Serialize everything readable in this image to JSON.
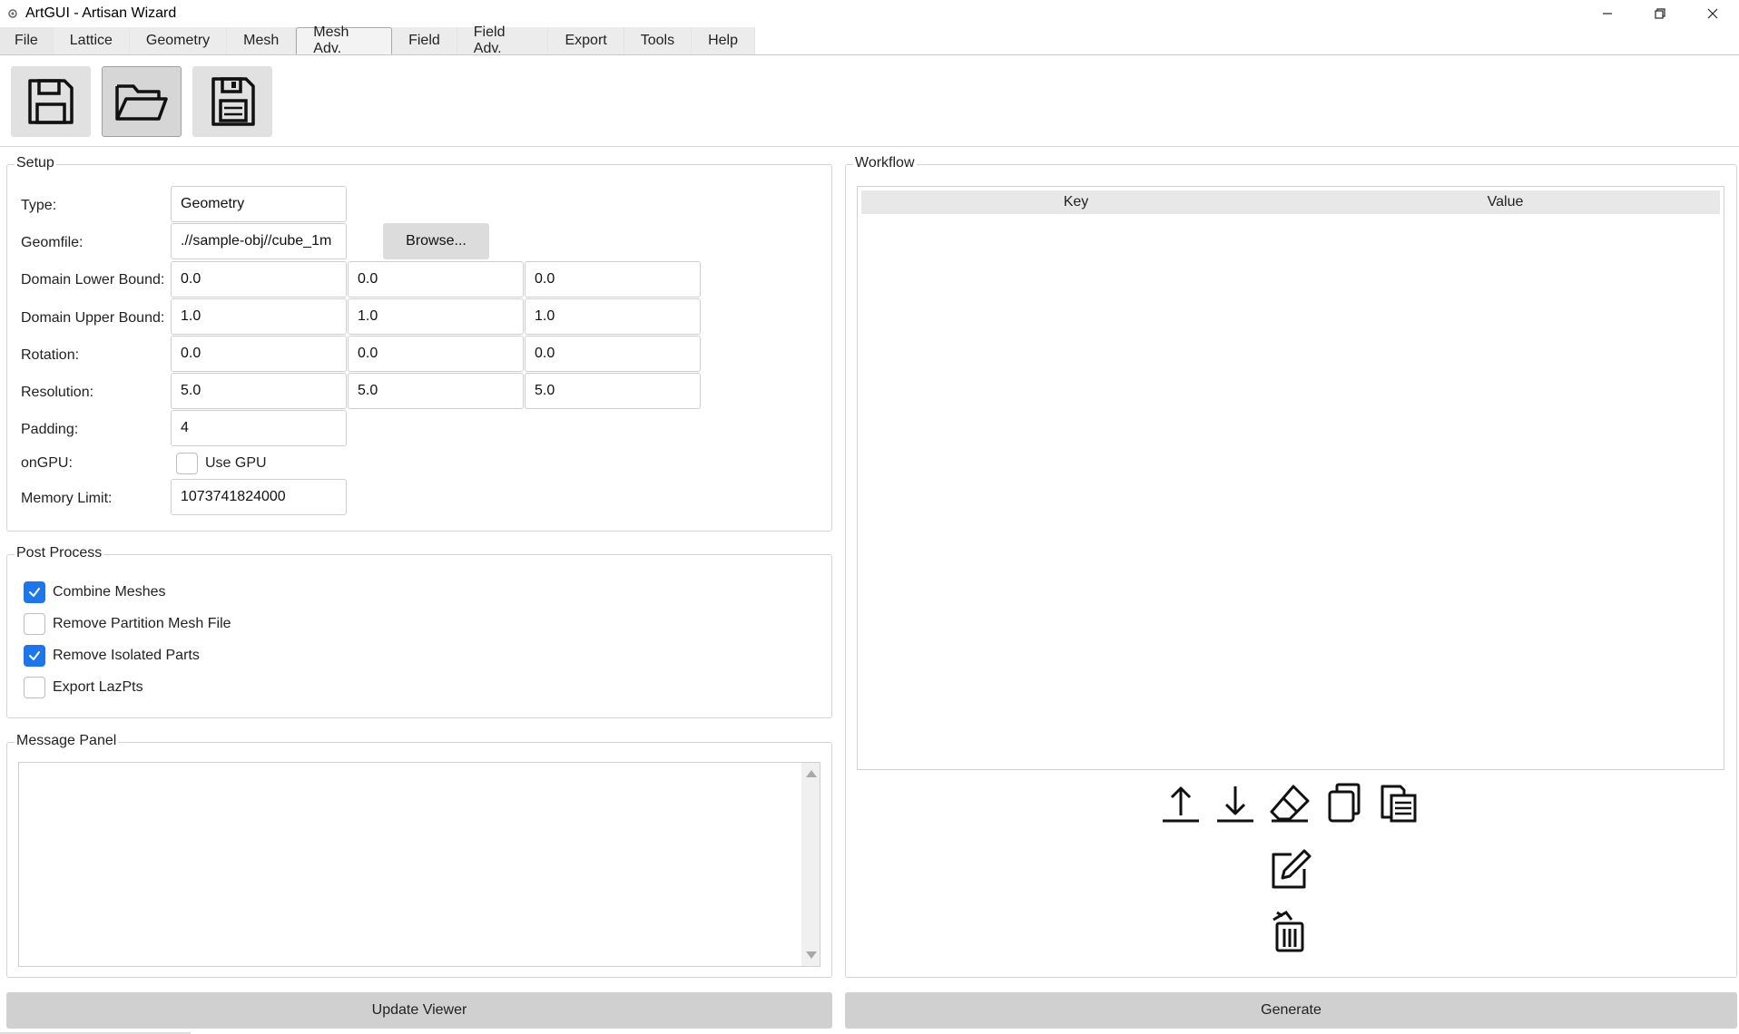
{
  "window": {
    "title": "ArtGUI - Artisan Wizard"
  },
  "tabs": [
    "File",
    "Lattice",
    "Geometry",
    "Mesh",
    "Mesh Adv.",
    "Field",
    "Field Adv.",
    "Export",
    "Tools",
    "Help"
  ],
  "active_tab": "Mesh Adv.",
  "toolbar": {
    "icons": [
      "save-icon",
      "open-folder-icon",
      "save-as-icon"
    ]
  },
  "setup": {
    "title": "Setup",
    "type_label": "Type:",
    "type_value": "Geometry",
    "geomfile_label": "Geomfile:",
    "geomfile_value": ".//sample-obj//cube_1m",
    "browse_label": "Browse...",
    "lower_label": "Domain Lower Bound:",
    "lower": [
      "0.0",
      "0.0",
      "0.0"
    ],
    "upper_label": "Domain Upper Bound:",
    "upper": [
      "1.0",
      "1.0",
      "1.0"
    ],
    "rotation_label": "Rotation:",
    "rotation": [
      "0.0",
      "0.0",
      "0.0"
    ],
    "resolution_label": "Resolution:",
    "resolution": [
      "5.0",
      "5.0",
      "5.0"
    ],
    "padding_label": "Padding:",
    "padding_value": "4",
    "ongpu_label": "onGPU:",
    "use_gpu_label": "Use GPU",
    "use_gpu_checked": false,
    "memory_label": "Memory Limit:",
    "memory_value": "1073741824000"
  },
  "post_process": {
    "title": "Post Process",
    "items": [
      {
        "label": "Combine Meshes",
        "checked": true
      },
      {
        "label": "Remove Partition Mesh File",
        "checked": false
      },
      {
        "label": "Remove Isolated Parts",
        "checked": true
      },
      {
        "label": "Export LazPts",
        "checked": false
      }
    ]
  },
  "message_panel": {
    "title": "Message Panel",
    "content": ""
  },
  "workflow": {
    "title": "Workflow",
    "columns": [
      "Key",
      "Value"
    ],
    "rows": [],
    "buttons": [
      "move-up-icon",
      "move-down-icon",
      "eraser-icon",
      "copy-icon",
      "paste-icon",
      "edit-icon",
      "delete-icon"
    ]
  },
  "buttons": {
    "update_viewer": "Update Viewer",
    "generate": "Generate"
  },
  "colors": {
    "accent": "#1e76e8",
    "button_bg": "#d0d0d0"
  }
}
